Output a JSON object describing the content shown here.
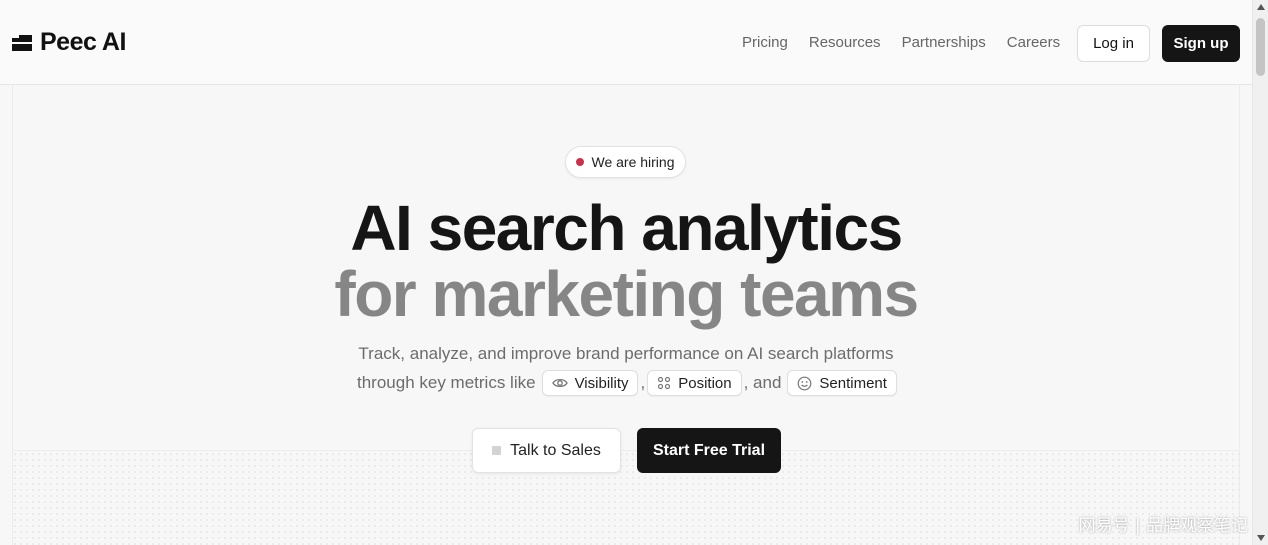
{
  "brand": {
    "name": "Peec AI"
  },
  "nav": {
    "items": [
      "Pricing",
      "Resources",
      "Partnerships",
      "Careers"
    ]
  },
  "header": {
    "login_label": "Log in",
    "signup_label": "Sign up"
  },
  "hero": {
    "badge": "We are hiring",
    "title_line1": "AI search analytics",
    "title_line2": "for marketing teams",
    "subtitle_line1": "Track, analyze, and improve brand performance on AI search platforms",
    "subtitle_prefix": "through key metrics like",
    "metrics": [
      "Visibility",
      "Position",
      "Sentiment"
    ],
    "sep_comma": ",",
    "sep_and": ", and",
    "cta_secondary": "Talk to Sales",
    "cta_primary": "Start Free Trial"
  },
  "watermark": "网易号 | 品牌观察笔记",
  "colors": {
    "accent_dark": "#151515",
    "hiring_dot": "#c8334a",
    "muted_title": "#868686"
  },
  "icons": [
    "eye-icon",
    "position-icon",
    "smile-icon",
    "square-icon",
    "logo-icon"
  ]
}
